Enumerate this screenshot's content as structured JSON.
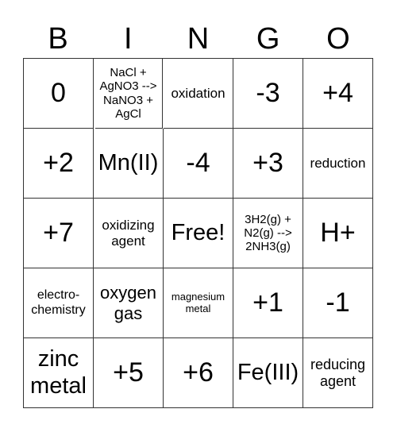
{
  "header": [
    "B",
    "I",
    "N",
    "G",
    "O"
  ],
  "cells": [
    "0",
    "NaCl + AgNO3 --> NaNO3 + AgCl",
    "oxidation",
    "-3",
    "+4",
    "+2",
    "Mn(II)",
    "-4",
    "+3",
    "reduction",
    "+7",
    "oxidizing agent",
    "Free!",
    "3H2(g) + N2(g) --> 2NH3(g)",
    "H+",
    "electro-chemistry",
    "oxygen gas",
    "magnesium metal",
    "+1",
    "-1",
    "zinc metal",
    "+5",
    "+6",
    "Fe(III)",
    "reducing agent"
  ]
}
